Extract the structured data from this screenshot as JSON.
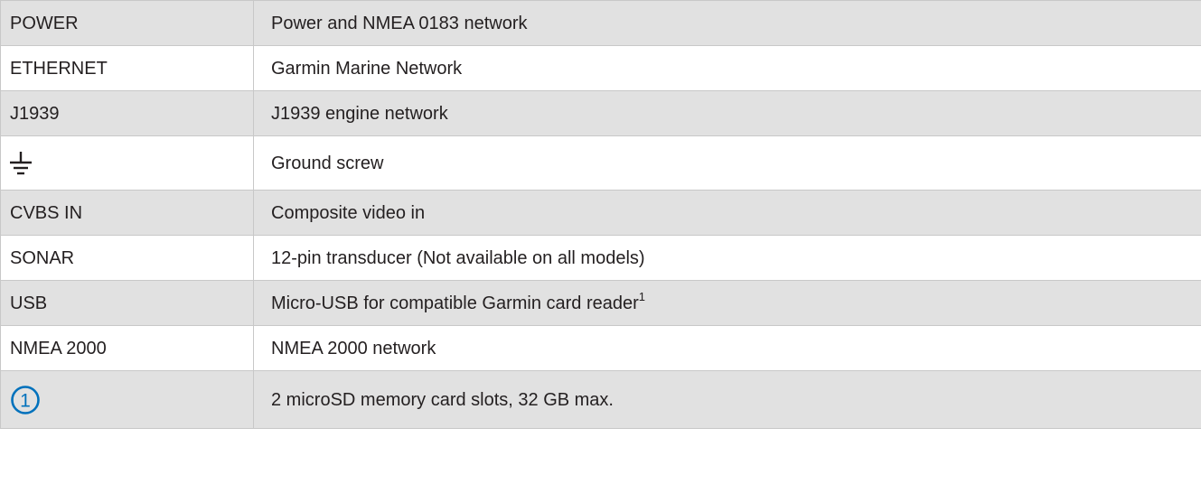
{
  "table": {
    "rows": [
      {
        "port": "POWER",
        "description": "Power and NMEA 0183 network"
      },
      {
        "port": "ETHERNET",
        "description": "Garmin Marine Network"
      },
      {
        "port": "J1939",
        "description": "J1939 engine network"
      },
      {
        "port_icon": "ground-symbol-icon",
        "description": "Ground screw"
      },
      {
        "port": "CVBS IN",
        "description": "Composite video in"
      },
      {
        "port": "SONAR",
        "description": "12-pin transducer (Not available on all models)"
      },
      {
        "port": "USB",
        "description": "Micro-USB for compatible Garmin card reader",
        "footnote": "1"
      },
      {
        "port": "NMEA 2000",
        "description": "NMEA 2000 network"
      },
      {
        "port_icon": "callout-1-icon",
        "callout_number": "1",
        "description": "2 microSD memory card slots, 32 GB max."
      }
    ]
  },
  "colors": {
    "shaded_row": "#e1e1e1",
    "plain_row": "#ffffff",
    "border": "#c8c8c8",
    "text": "#231f20",
    "callout_icon": "#0071bc"
  }
}
